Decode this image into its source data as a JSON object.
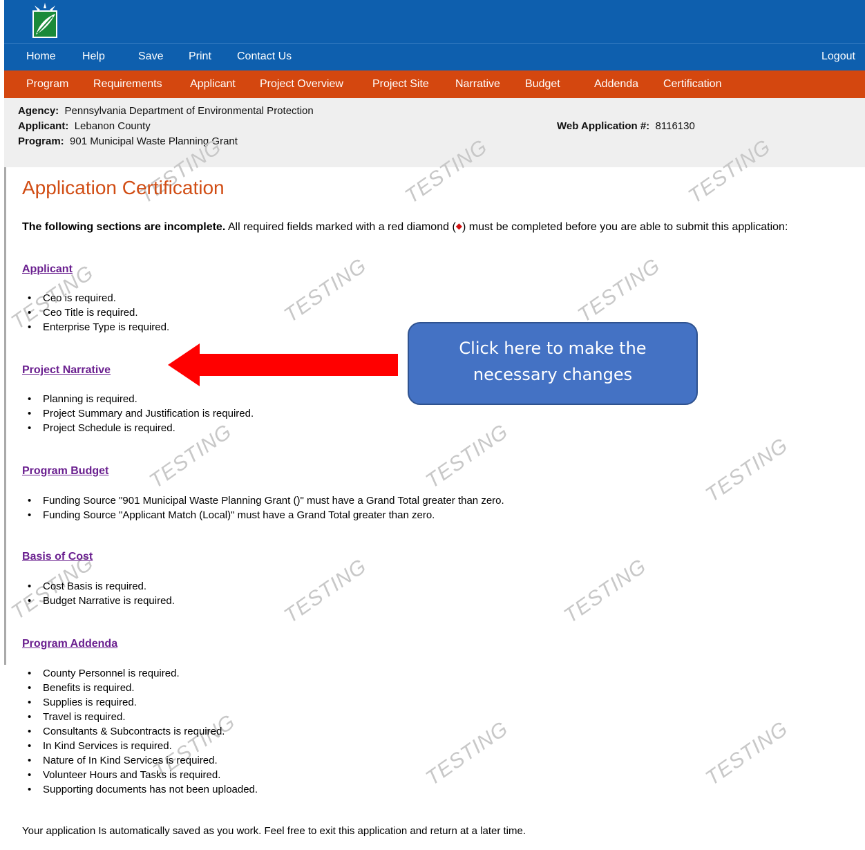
{
  "nav_main": {
    "home": "Home",
    "help": "Help",
    "save": "Save",
    "print": "Print",
    "contact": "Contact Us",
    "logout": "Logout"
  },
  "nav_sections": [
    "Program",
    "Requirements",
    "Applicant",
    "Project Overview",
    "Project Site",
    "Narrative",
    "Budget",
    "Addenda",
    "Certification"
  ],
  "info": {
    "agency_label": "Agency:",
    "agency": "Pennsylvania Department of Environmental Protection",
    "applicant_label": "Applicant:",
    "applicant": "Lebanon County",
    "program_label": "Program:",
    "program": "901 Municipal Waste Planning Grant",
    "webapp_label": "Web Application #:",
    "webapp": "8116130"
  },
  "page_title": "Application Certification",
  "intro": {
    "bold": "The following sections are incomplete.",
    "text1": " All required fields marked with a red diamond (",
    "diamond": "◆",
    "text2": ") must be completed before you are able to submit this application:"
  },
  "sections": [
    {
      "title": "Applicant",
      "items": [
        "Ceo is required.",
        "Ceo Title is required.",
        "Enterprise Type is required."
      ]
    },
    {
      "title": "Project Narrative",
      "items": [
        "Planning is required.",
        "Project Summary and Justification is required.",
        "Project Schedule is required."
      ]
    },
    {
      "title": "Program Budget",
      "items": [
        "Funding Source \"901 Municipal Waste Planning Grant ()\" must have a Grand Total greater than zero.",
        "Funding Source \"Applicant Match (Local)\" must have a Grand Total greater than zero."
      ]
    },
    {
      "title": "Basis of Cost",
      "items": [
        "Cost Basis is required.",
        "Budget Narrative is required."
      ]
    },
    {
      "title": "Program Addenda",
      "items": [
        "County Personnel is required.",
        "Benefits is required.",
        "Supplies is required.",
        "Travel is required.",
        "Consultants & Subcontracts is required.",
        "In Kind Services is required.",
        "Nature of In Kind Services is required.",
        "Volunteer Hours and Tasks is required.",
        "Supporting documents has not been uploaded."
      ]
    }
  ],
  "footer": "Your application Is automatically saved as you work. Feel free to exit this application and return at a later time.",
  "callout": {
    "line1": "Click here to make the",
    "line2": "necessary changes"
  },
  "watermark": "TESTING",
  "colors": {
    "nav_blue": "#0e5fae",
    "nav_orange": "#d4470f",
    "title_orange": "#d14d14",
    "link_purple": "#6a1f8f",
    "callout_blue": "#4472c4",
    "arrow_red": "#ff0000"
  }
}
